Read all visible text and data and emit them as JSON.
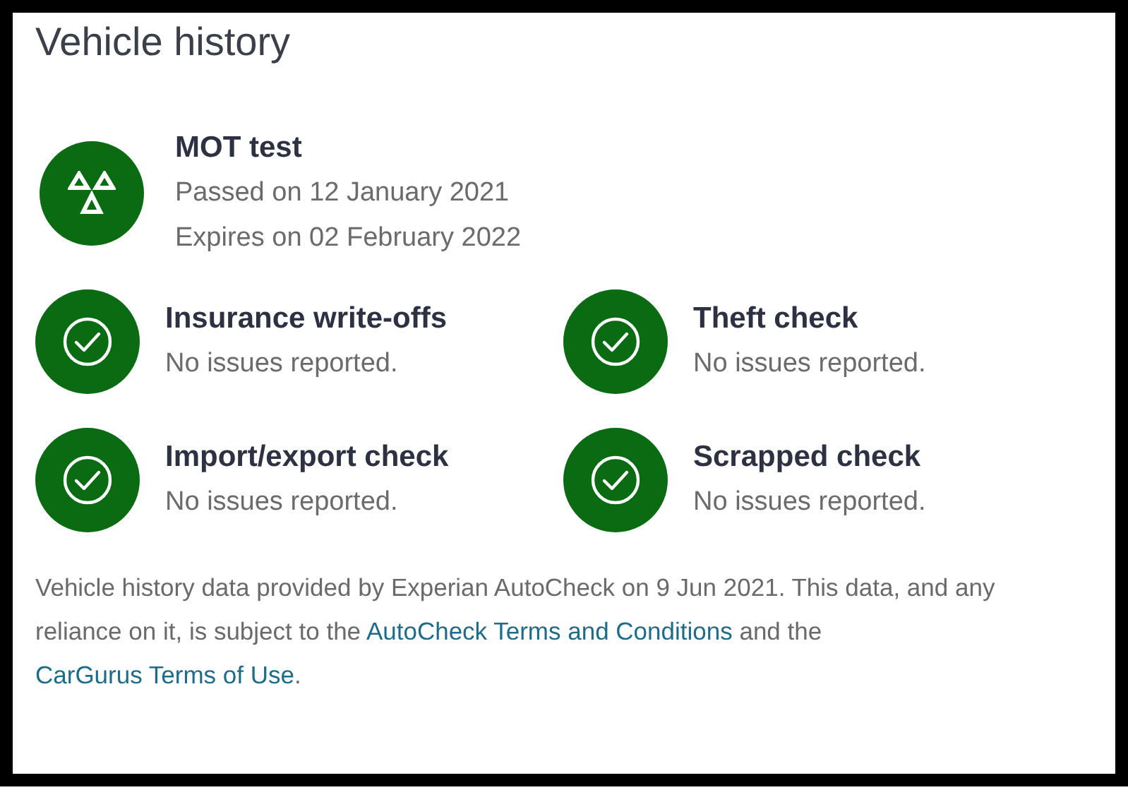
{
  "title": "Vehicle history",
  "mot": {
    "kind": "mot",
    "title": "MOT test",
    "lines": [
      "Passed on 12 January 2021",
      "Expires on 02 February 2022"
    ]
  },
  "checks": [
    {
      "kind": "check",
      "title": "Insurance write-offs",
      "status": "No issues reported."
    },
    {
      "kind": "check",
      "title": "Theft check",
      "status": "No issues reported."
    },
    {
      "kind": "check",
      "title": "Import/export check",
      "status": "No issues reported."
    },
    {
      "kind": "check",
      "title": "Scrapped check",
      "status": "No issues reported."
    }
  ],
  "footer": [
    {
      "kind": "text",
      "text": "Vehicle history data provided by Experian AutoCheck on 9 Jun 2021. This data, and any reliance on it, is subject to the "
    },
    {
      "kind": "link",
      "text": "AutoCheck Terms and Conditions"
    },
    {
      "kind": "text",
      "text": " and the "
    },
    {
      "kind": "link",
      "text": "CarGurus Terms of Use"
    },
    {
      "kind": "text",
      "text": "."
    }
  ]
}
